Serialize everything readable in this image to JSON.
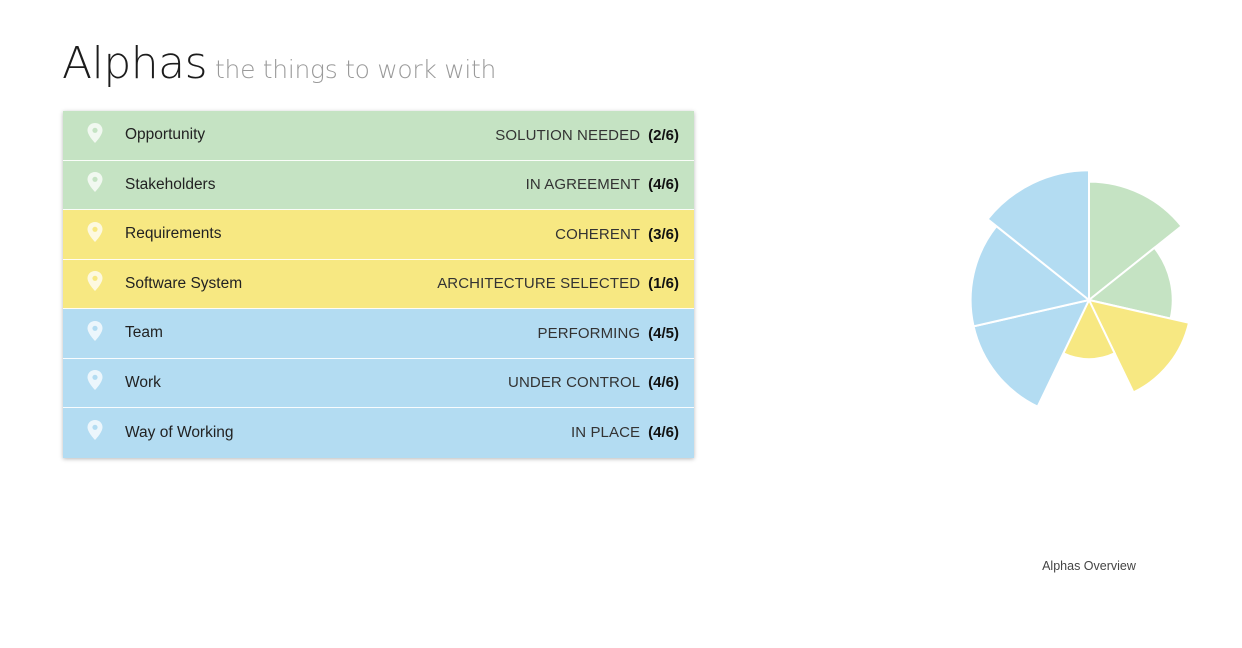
{
  "header": {
    "title": "Alphas",
    "subtitle": "the things to work with"
  },
  "colors": {
    "customer": "#c5e3c3",
    "solution": "#f7e882",
    "endeavor": "#b3dcf2",
    "pin": "#ffffff"
  },
  "alphas": [
    {
      "name": "Opportunity",
      "state": "SOLUTION NEEDED",
      "progress": "(2/6)",
      "area": "customer",
      "icon": "map-pin-icon"
    },
    {
      "name": "Stakeholders",
      "state": "IN AGREEMENT",
      "progress": "(4/6)",
      "area": "customer",
      "icon": "map-pin-icon"
    },
    {
      "name": "Requirements",
      "state": "COHERENT",
      "progress": "(3/6)",
      "area": "solution",
      "icon": "map-pin-icon"
    },
    {
      "name": "Software System",
      "state": "ARCHITECTURE SELECTED",
      "progress": "(1/6)",
      "area": "solution",
      "icon": "map-pin-icon"
    },
    {
      "name": "Team",
      "state": "PERFORMING",
      "progress": "(4/5)",
      "area": "endeavor",
      "icon": "map-pin-icon"
    },
    {
      "name": "Work",
      "state": "UNDER CONTROL",
      "progress": "(4/6)",
      "area": "endeavor",
      "icon": "map-pin-icon"
    },
    {
      "name": "Way of Working",
      "state": "IN PLACE",
      "progress": "(4/6)",
      "area": "endeavor",
      "icon": "map-pin-icon"
    }
  ],
  "chart_data": {
    "type": "polar-area",
    "title": "Alphas Overview",
    "categories": [
      "Opportunity",
      "Stakeholders",
      "Requirements",
      "Software System",
      "Team",
      "Work",
      "Way of Working"
    ],
    "values": [
      2,
      4,
      3,
      1,
      4,
      4,
      4
    ],
    "max_values": [
      6,
      6,
      6,
      6,
      5,
      6,
      6
    ],
    "fractions": [
      0.333,
      0.667,
      0.5,
      0.167,
      0.8,
      0.667,
      0.667
    ],
    "slice_colors": [
      "#c5e3c3",
      "#c5e3c3",
      "#f7e882",
      "#f7e882",
      "#b3dcf2",
      "#b3dcf2",
      "#b3dcf2"
    ],
    "rendered_order_clockwise_from_top": [
      "Stakeholders",
      "Opportunity",
      "Requirements",
      "Software System",
      "Way of Working",
      "Work",
      "Team"
    ],
    "legend": "none"
  }
}
